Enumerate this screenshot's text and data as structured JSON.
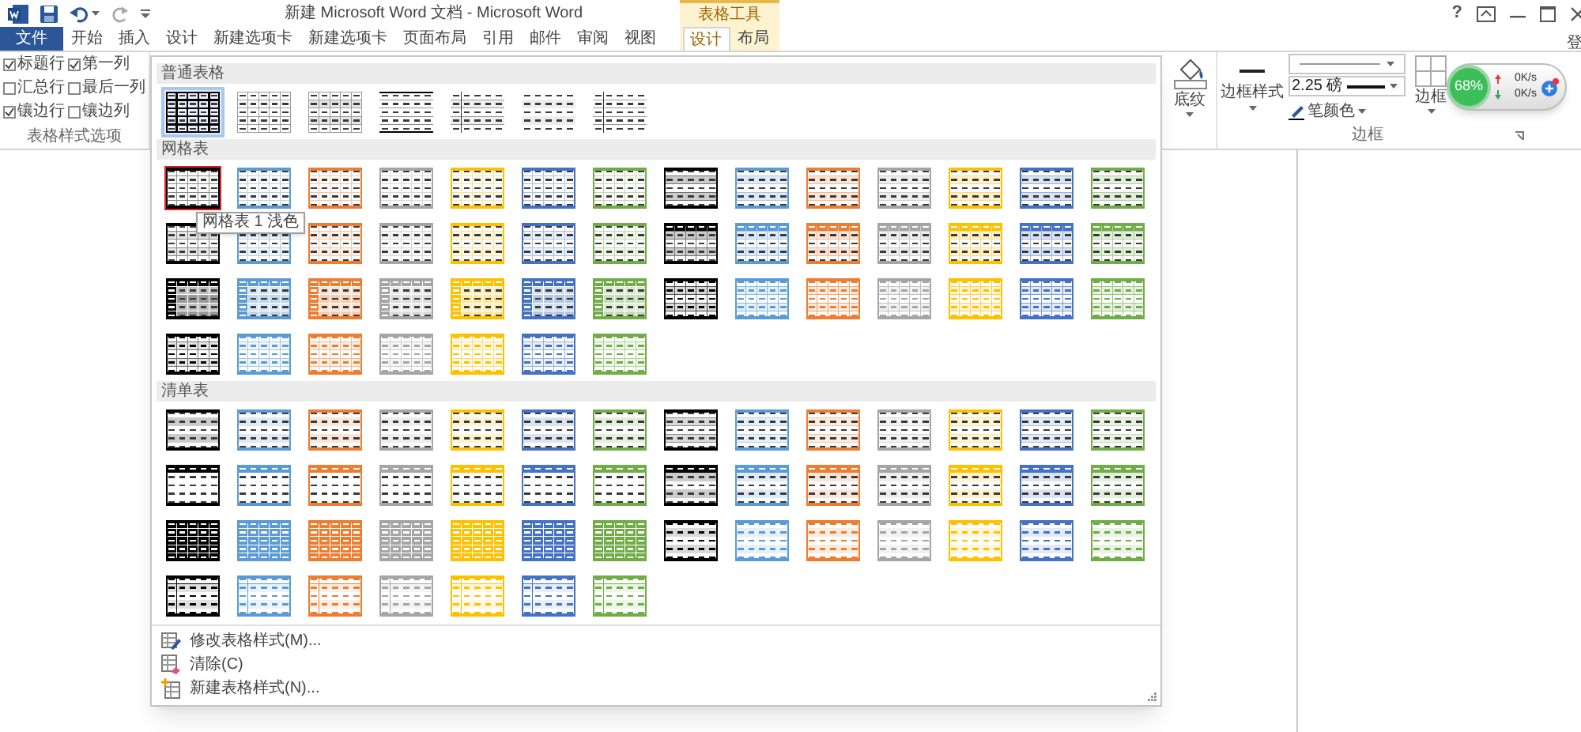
{
  "title_bar": {
    "title": "新建 Microsoft Word 文档 - Microsoft Word",
    "context_label": "表格工具",
    "help": "?"
  },
  "tabs": [
    {
      "label": "文件",
      "kind": "file",
      "selected": false
    },
    {
      "label": "开始",
      "kind": "main",
      "selected": false
    },
    {
      "label": "插入",
      "kind": "main",
      "selected": false
    },
    {
      "label": "设计",
      "kind": "main",
      "selected": false
    },
    {
      "label": "新建选项卡",
      "kind": "main",
      "selected": false
    },
    {
      "label": "新建选项卡",
      "kind": "main",
      "selected": false
    },
    {
      "label": "页面布局",
      "kind": "main",
      "selected": false
    },
    {
      "label": "引用",
      "kind": "main",
      "selected": false
    },
    {
      "label": "邮件",
      "kind": "main",
      "selected": false
    },
    {
      "label": "审阅",
      "kind": "main",
      "selected": false
    },
    {
      "label": "视图",
      "kind": "main",
      "selected": false
    },
    {
      "label": "设计",
      "kind": "context",
      "selected": true
    },
    {
      "label": "布局",
      "kind": "context",
      "selected": false
    }
  ],
  "signin": "登",
  "style_options": {
    "options": [
      {
        "label": "标题行",
        "checked": true
      },
      {
        "label": "第一列",
        "checked": true
      },
      {
        "label": "汇总行",
        "checked": false
      },
      {
        "label": "最后一列",
        "checked": false
      },
      {
        "label": "镶边行",
        "checked": true
      },
      {
        "label": "镶边列",
        "checked": false
      }
    ],
    "group_label": "表格样式选项"
  },
  "gallery": {
    "tooltip": "网格表 1 浅色",
    "sections": [
      {
        "title": "普通表格",
        "styles": [
          {
            "kind": "table_grid",
            "selected": true,
            "hovered": false
          },
          {
            "kind": "grid_light",
            "selected": false,
            "hovered": false
          },
          {
            "kind": "plain_1",
            "selected": false,
            "hovered": false
          },
          {
            "kind": "plain_2",
            "selected": false,
            "hovered": false
          },
          {
            "kind": "plain_3",
            "selected": false,
            "hovered": false
          },
          {
            "kind": "plain_4",
            "selected": false,
            "hovered": false
          },
          {
            "kind": "plain_5",
            "selected": false,
            "hovered": false
          }
        ]
      },
      {
        "title": "网格表",
        "styles": [
          {
            "kind": "light_grid",
            "color": "#000000",
            "selected": false,
            "hovered": true
          },
          {
            "kind": "light_grid",
            "color": "#5b9bd5",
            "selected": false,
            "hovered": false
          },
          {
            "kind": "light_grid",
            "color": "#ed7d31",
            "selected": false,
            "hovered": false
          },
          {
            "kind": "light_grid",
            "color": "#a5a5a5",
            "selected": false,
            "hovered": false
          },
          {
            "kind": "light_grid",
            "color": "#ffc000",
            "selected": false,
            "hovered": false
          },
          {
            "kind": "light_grid",
            "color": "#4472c4",
            "selected": false,
            "hovered": false
          },
          {
            "kind": "light_grid",
            "color": "#70ad47",
            "selected": false,
            "hovered": false
          },
          {
            "kind": "banded_lined",
            "color": "#000000",
            "selected": false,
            "hovered": false
          },
          {
            "kind": "banded_lined",
            "color": "#5b9bd5",
            "selected": false,
            "hovered": false
          },
          {
            "kind": "banded_lined",
            "color": "#ed7d31",
            "selected": false,
            "hovered": false
          },
          {
            "kind": "banded_lined",
            "color": "#a5a5a5",
            "selected": false,
            "hovered": false
          },
          {
            "kind": "banded_lined",
            "color": "#ffc000",
            "selected": false,
            "hovered": false
          },
          {
            "kind": "banded_lined",
            "color": "#4472c4",
            "selected": false,
            "hovered": false
          },
          {
            "kind": "banded_lined",
            "color": "#70ad47",
            "selected": false,
            "hovered": false
          },
          {
            "kind": "banded_open",
            "color": "#000000",
            "selected": false,
            "hovered": false
          },
          {
            "kind": "banded_open",
            "color": "#5b9bd5",
            "selected": false,
            "hovered": false
          },
          {
            "kind": "banded_open",
            "color": "#ed7d31",
            "selected": false,
            "hovered": false
          },
          {
            "kind": "banded_open",
            "color": "#a5a5a5",
            "selected": false,
            "hovered": false
          },
          {
            "kind": "banded_open",
            "color": "#ffc000",
            "selected": false,
            "hovered": false
          },
          {
            "kind": "banded_open",
            "color": "#4472c4",
            "selected": false,
            "hovered": false
          },
          {
            "kind": "banded_open",
            "color": "#70ad47",
            "selected": false,
            "hovered": false
          },
          {
            "kind": "header_grid",
            "color": "#000000",
            "selected": false,
            "hovered": false
          },
          {
            "kind": "header_grid",
            "color": "#5b9bd5",
            "selected": false,
            "hovered": false
          },
          {
            "kind": "header_grid",
            "color": "#ed7d31",
            "selected": false,
            "hovered": false
          },
          {
            "kind": "header_grid",
            "color": "#a5a5a5",
            "selected": false,
            "hovered": false
          },
          {
            "kind": "header_grid",
            "color": "#ffc000",
            "selected": false,
            "hovered": false
          },
          {
            "kind": "header_grid",
            "color": "#4472c4",
            "selected": false,
            "hovered": false
          },
          {
            "kind": "header_grid",
            "color": "#70ad47",
            "selected": false,
            "hovered": false
          },
          {
            "kind": "dark",
            "color": "#000000",
            "selected": false,
            "hovered": false
          },
          {
            "kind": "dark",
            "color": "#5b9bd5",
            "selected": false,
            "hovered": false
          },
          {
            "kind": "dark",
            "color": "#ed7d31",
            "selected": false,
            "hovered": false
          },
          {
            "kind": "dark",
            "color": "#a5a5a5",
            "selected": false,
            "hovered": false
          },
          {
            "kind": "dark",
            "color": "#ffc000",
            "selected": false,
            "hovered": false
          },
          {
            "kind": "dark",
            "color": "#4472c4",
            "selected": false,
            "hovered": false
          },
          {
            "kind": "dark",
            "color": "#70ad47",
            "selected": false,
            "hovered": false
          },
          {
            "kind": "colorful_grid",
            "color": "#000000",
            "selected": false,
            "hovered": false
          },
          {
            "kind": "colorful_grid",
            "color": "#5b9bd5",
            "selected": false,
            "hovered": false
          },
          {
            "kind": "colorful_grid",
            "color": "#ed7d31",
            "selected": false,
            "hovered": false
          },
          {
            "kind": "colorful_grid",
            "color": "#a5a5a5",
            "selected": false,
            "hovered": false
          },
          {
            "kind": "colorful_grid",
            "color": "#ffc000",
            "selected": false,
            "hovered": false
          },
          {
            "kind": "colorful_grid",
            "color": "#4472c4",
            "selected": false,
            "hovered": false
          },
          {
            "kind": "colorful_grid",
            "color": "#70ad47",
            "selected": false,
            "hovered": false
          },
          {
            "kind": "colorful_open",
            "color": "#000000",
            "selected": false,
            "hovered": false
          },
          {
            "kind": "colorful_open",
            "color": "#5b9bd5",
            "selected": false,
            "hovered": false
          },
          {
            "kind": "colorful_open",
            "color": "#ed7d31",
            "selected": false,
            "hovered": false
          },
          {
            "kind": "colorful_open",
            "color": "#a5a5a5",
            "selected": false,
            "hovered": false
          },
          {
            "kind": "colorful_open",
            "color": "#ffc000",
            "selected": false,
            "hovered": false
          },
          {
            "kind": "colorful_open",
            "color": "#4472c4",
            "selected": false,
            "hovered": false
          },
          {
            "kind": "colorful_open",
            "color": "#70ad47",
            "selected": false,
            "hovered": false
          }
        ]
      },
      {
        "title": "清单表",
        "styles": [
          {
            "kind": "list_banded",
            "color": "#000000",
            "selected": false,
            "hovered": false
          },
          {
            "kind": "list_banded",
            "color": "#5b9bd5",
            "selected": false,
            "hovered": false
          },
          {
            "kind": "list_banded",
            "color": "#ed7d31",
            "selected": false,
            "hovered": false
          },
          {
            "kind": "list_banded",
            "color": "#a5a5a5",
            "selected": false,
            "hovered": false
          },
          {
            "kind": "list_banded",
            "color": "#ffc000",
            "selected": false,
            "hovered": false
          },
          {
            "kind": "list_banded",
            "color": "#4472c4",
            "selected": false,
            "hovered": false
          },
          {
            "kind": "list_banded",
            "color": "#70ad47",
            "selected": false,
            "hovered": false
          },
          {
            "kind": "list_lined",
            "color": "#000000",
            "selected": false,
            "hovered": false
          },
          {
            "kind": "list_lined",
            "color": "#5b9bd5",
            "selected": false,
            "hovered": false
          },
          {
            "kind": "list_lined",
            "color": "#ed7d31",
            "selected": false,
            "hovered": false
          },
          {
            "kind": "list_lined",
            "color": "#a5a5a5",
            "selected": false,
            "hovered": false
          },
          {
            "kind": "list_lined",
            "color": "#ffc000",
            "selected": false,
            "hovered": false
          },
          {
            "kind": "list_lined",
            "color": "#4472c4",
            "selected": false,
            "hovered": false
          },
          {
            "kind": "list_lined",
            "color": "#70ad47",
            "selected": false,
            "hovered": false
          },
          {
            "kind": "list_header_box",
            "color": "#000000",
            "selected": false,
            "hovered": false
          },
          {
            "kind": "list_header_box",
            "color": "#5b9bd5",
            "selected": false,
            "hovered": false
          },
          {
            "kind": "list_header_box",
            "color": "#ed7d31",
            "selected": false,
            "hovered": false
          },
          {
            "kind": "list_header_box",
            "color": "#a5a5a5",
            "selected": false,
            "hovered": false
          },
          {
            "kind": "list_header_box",
            "color": "#ffc000",
            "selected": false,
            "hovered": false
          },
          {
            "kind": "list_header_box",
            "color": "#4472c4",
            "selected": false,
            "hovered": false
          },
          {
            "kind": "list_header_box",
            "color": "#70ad47",
            "selected": false,
            "hovered": false
          },
          {
            "kind": "list_header",
            "color": "#000000",
            "selected": false,
            "hovered": false
          },
          {
            "kind": "list_header",
            "color": "#5b9bd5",
            "selected": false,
            "hovered": false
          },
          {
            "kind": "list_header",
            "color": "#ed7d31",
            "selected": false,
            "hovered": false
          },
          {
            "kind": "list_header",
            "color": "#a5a5a5",
            "selected": false,
            "hovered": false
          },
          {
            "kind": "list_header",
            "color": "#ffc000",
            "selected": false,
            "hovered": false
          },
          {
            "kind": "list_header",
            "color": "#4472c4",
            "selected": false,
            "hovered": false
          },
          {
            "kind": "list_header",
            "color": "#70ad47",
            "selected": false,
            "hovered": false
          },
          {
            "kind": "list_filled",
            "color": "#000000",
            "selected": false,
            "hovered": false
          },
          {
            "kind": "list_filled",
            "color": "#5b9bd5",
            "selected": false,
            "hovered": false
          },
          {
            "kind": "list_filled",
            "color": "#ed7d31",
            "selected": false,
            "hovered": false
          },
          {
            "kind": "list_filled",
            "color": "#a5a5a5",
            "selected": false,
            "hovered": false
          },
          {
            "kind": "list_filled",
            "color": "#ffc000",
            "selected": false,
            "hovered": false
          },
          {
            "kind": "list_filled",
            "color": "#4472c4",
            "selected": false,
            "hovered": false
          },
          {
            "kind": "list_filled",
            "color": "#70ad47",
            "selected": false,
            "hovered": false
          },
          {
            "kind": "list_rules",
            "color": "#000000",
            "selected": false,
            "hovered": false
          },
          {
            "kind": "list_rules",
            "color": "#5b9bd5",
            "selected": false,
            "hovered": false
          },
          {
            "kind": "list_rules",
            "color": "#ed7d31",
            "selected": false,
            "hovered": false
          },
          {
            "kind": "list_rules",
            "color": "#a5a5a5",
            "selected": false,
            "hovered": false
          },
          {
            "kind": "list_rules",
            "color": "#ffc000",
            "selected": false,
            "hovered": false
          },
          {
            "kind": "list_rules",
            "color": "#4472c4",
            "selected": false,
            "hovered": false
          },
          {
            "kind": "list_rules",
            "color": "#70ad47",
            "selected": false,
            "hovered": false
          },
          {
            "kind": "list_first_col",
            "color": "#000000",
            "selected": false,
            "hovered": false
          },
          {
            "kind": "list_first_col",
            "color": "#5b9bd5",
            "selected": false,
            "hovered": false
          },
          {
            "kind": "list_first_col",
            "color": "#ed7d31",
            "selected": false,
            "hovered": false
          },
          {
            "kind": "list_first_col",
            "color": "#a5a5a5",
            "selected": false,
            "hovered": false
          },
          {
            "kind": "list_first_col",
            "color": "#ffc000",
            "selected": false,
            "hovered": false
          },
          {
            "kind": "list_first_col",
            "color": "#4472c4",
            "selected": false,
            "hovered": false
          },
          {
            "kind": "list_first_col",
            "color": "#70ad47",
            "selected": false,
            "hovered": false
          }
        ]
      }
    ],
    "menu": [
      {
        "label": "修改表格样式(M)...",
        "kind": "modify"
      },
      {
        "label": "清除(C)",
        "kind": "clear"
      },
      {
        "label": "新建表格样式(N)...",
        "kind": "new"
      }
    ]
  },
  "borders": {
    "shading_label": "底纹",
    "border_style_label": "边框样式",
    "pen_weight": "2.25 磅",
    "pen_color_label": "笔颜色",
    "borders_label": "边框",
    "group_label": "边框"
  },
  "net_widget": {
    "percent": "68%",
    "upload": "0K/s",
    "download": "0K/s"
  }
}
